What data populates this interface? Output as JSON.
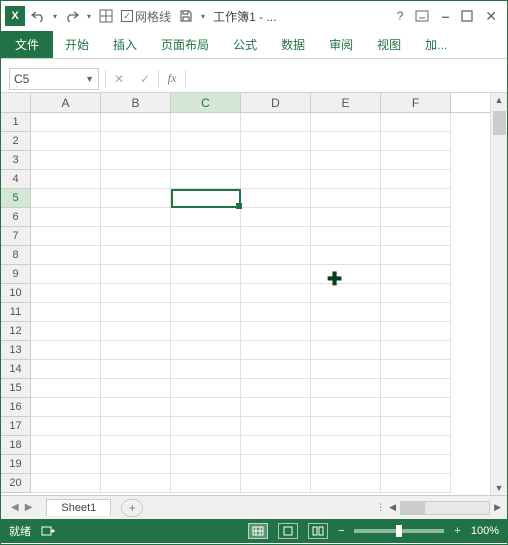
{
  "app": {
    "icon_text": "X",
    "gridlines_label": "网格线",
    "doc_title": "工作簿1 - ..."
  },
  "tabs": {
    "file": "文件",
    "home": "开始",
    "insert": "插入",
    "layout": "页面布局",
    "formulas": "公式",
    "data": "数据",
    "review": "审阅",
    "view": "视图",
    "addins": "加..."
  },
  "formula": {
    "cell_ref": "C5",
    "fx": "fx"
  },
  "columns": [
    "A",
    "B",
    "C",
    "D",
    "E",
    "F"
  ],
  "rows": [
    "1",
    "2",
    "3",
    "4",
    "5",
    "6",
    "7",
    "8",
    "9",
    "10",
    "11",
    "12",
    "13",
    "14",
    "15",
    "16",
    "17",
    "18",
    "19",
    "20"
  ],
  "active": {
    "col": "C",
    "row": "5"
  },
  "sheets": {
    "sheet1": "Sheet1",
    "new": "+"
  },
  "status": {
    "ready": "就绪",
    "zoom": "100%",
    "minus": "−",
    "plus": "+"
  }
}
